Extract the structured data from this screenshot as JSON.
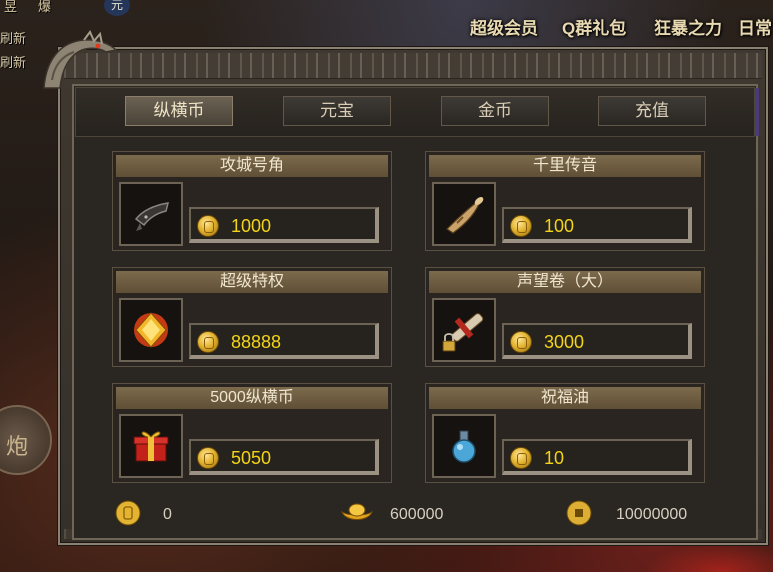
{
  "topbar": {
    "left_lines": [
      "昱",
      "爆",
      "刷新",
      "刷新"
    ],
    "menu": [
      "超级会员",
      "Q群礼包",
      "狂暴之力",
      "日常"
    ],
    "badge": "元"
  },
  "side_button": "炮",
  "tabs": [
    {
      "label": "纵横币",
      "active": true
    },
    {
      "label": "元宝",
      "active": false
    },
    {
      "label": "金币",
      "active": false
    },
    {
      "label": "充值",
      "active": false
    }
  ],
  "items": [
    {
      "name": "攻城号角",
      "price": "1000",
      "icon": "siege-horn-icon"
    },
    {
      "name": "千里传音",
      "price": "100",
      "icon": "horn-icon"
    },
    {
      "name": "超级特权",
      "price": "88888",
      "icon": "gold-gem-icon"
    },
    {
      "name": "声望卷（大）",
      "price": "3000",
      "icon": "locked-scroll-icon"
    },
    {
      "name": "5000纵横币",
      "price": "5050",
      "icon": "gift-box-icon"
    },
    {
      "name": "祝福油",
      "price": "10",
      "icon": "blessing-oil-icon"
    }
  ],
  "balances": {
    "zongheng": "0",
    "yuanbao": "600000",
    "gold": "10000000"
  },
  "colors": {
    "price_text": "#f2d419",
    "card_title_bg": "#7c6a4c",
    "panel_bg": "#3f3830"
  }
}
